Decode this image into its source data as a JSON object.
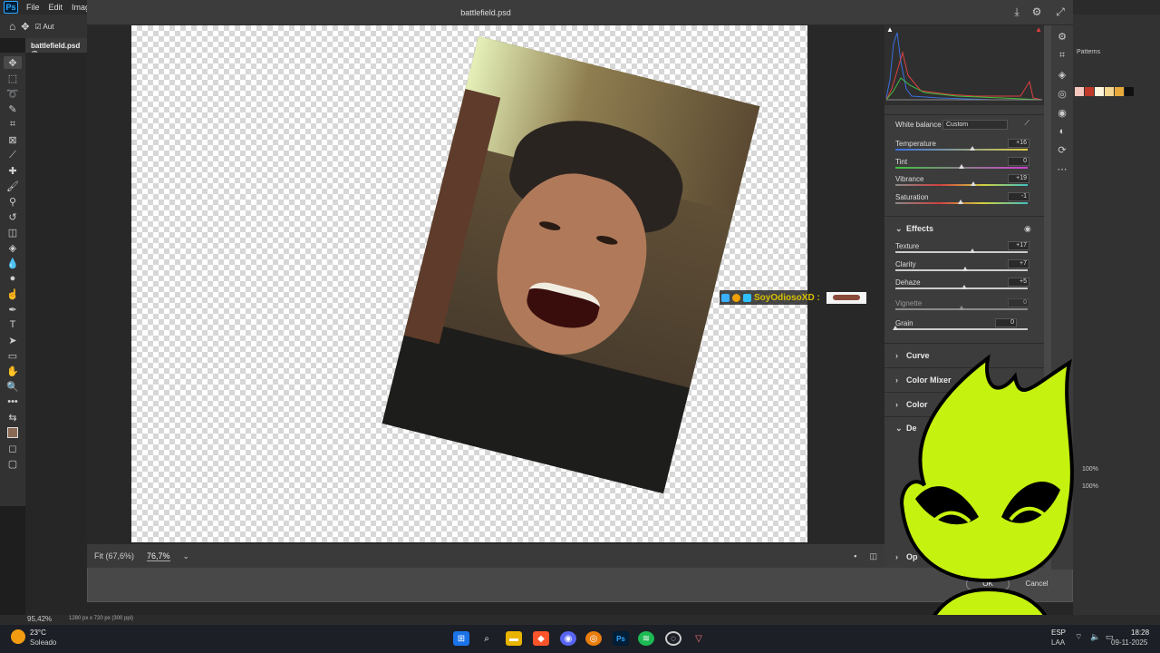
{
  "menubar": {
    "items": [
      "File",
      "Edit",
      "Image"
    ]
  },
  "optbar": {
    "auto_label": "Aut"
  },
  "doc_tab": "battlefield.psd @",
  "dialog": {
    "title": "battlefield.psd",
    "fit_label": "Fit (67,6%)",
    "zoom": "76,7%",
    "ok": "OK",
    "cancel": "Cancel"
  },
  "panel": {
    "white_balance_label": "White balance",
    "white_balance_value": "Custom",
    "temperature": {
      "label": "Temperature",
      "value": "+16",
      "level": 0.58
    },
    "tint": {
      "label": "Tint",
      "value": "0",
      "level": 0.5
    },
    "vibrance": {
      "label": "Vibrance",
      "value": "+19",
      "level": 0.59
    },
    "saturation": {
      "label": "Saturation",
      "value": "-1",
      "level": 0.49
    },
    "effects_label": "Effects",
    "texture": {
      "label": "Texture",
      "value": "+17",
      "level": 0.58
    },
    "clarity": {
      "label": "Clarity",
      "value": "+7",
      "level": 0.53
    },
    "dehaze": {
      "label": "Dehaze",
      "value": "+5",
      "level": 0.52
    },
    "vignette": {
      "label": "Vignette",
      "value": "0",
      "level": 0.5
    },
    "grain": {
      "label": "Grain",
      "value": "0",
      "level": 0.0
    },
    "sections": [
      "Curve",
      "Color Mixer",
      "Color",
      "De",
      "Op"
    ]
  },
  "overlay": {
    "username": "SoyOdiosoXD :"
  },
  "ps_right": {
    "patterns_label": "Patterns",
    "opacity1": "100%",
    "opacity2": "100%"
  },
  "status": {
    "zoom": "95,42%",
    "info": "1280 px x 720 px (300 ppi)"
  },
  "taskbar": {
    "weather_temp": "23°C",
    "weather_desc": "Soleado",
    "lang": "ESP",
    "lang2": "LAA",
    "time": "18:28",
    "date": "09-11-2025"
  }
}
